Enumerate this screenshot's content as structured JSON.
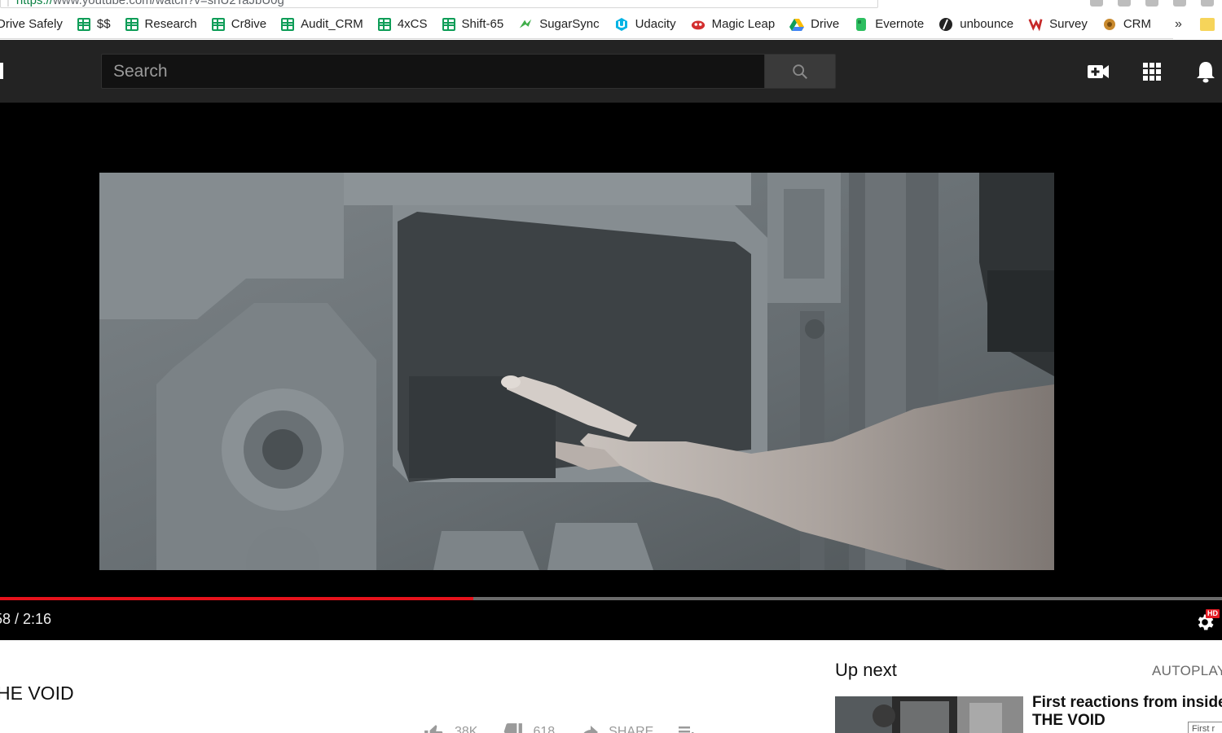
{
  "browser": {
    "url_scheme": "https://",
    "url_rest": "www.youtube.com/watch?v=shU2TaJbU0g",
    "bookmarks": [
      {
        "label": "Drive Safely",
        "icon": "doc-icon"
      },
      {
        "label": "$$",
        "icon": "sheets-icon"
      },
      {
        "label": "Research",
        "icon": "sheets-icon"
      },
      {
        "label": "Cr8ive",
        "icon": "sheets-icon"
      },
      {
        "label": "Audit_CRM",
        "icon": "sheets-icon"
      },
      {
        "label": "4xCS",
        "icon": "sheets-icon"
      },
      {
        "label": "Shift-65",
        "icon": "sheets-icon"
      },
      {
        "label": "SugarSync",
        "icon": "sugarsync-icon"
      },
      {
        "label": "Udacity",
        "icon": "udacity-icon"
      },
      {
        "label": "Magic Leap",
        "icon": "magic-leap-icon"
      },
      {
        "label": "Drive",
        "icon": "google-drive-icon"
      },
      {
        "label": "Evernote",
        "icon": "evernote-icon"
      },
      {
        "label": "unbounce",
        "icon": "unbounce-icon"
      },
      {
        "label": "Survey",
        "icon": "survey-icon"
      },
      {
        "label": "CRM",
        "icon": "crm-icon"
      }
    ],
    "more_chevron": "»"
  },
  "masthead": {
    "search_placeholder": "Search"
  },
  "player": {
    "time_display": "58 / 2:16",
    "progress_fraction": 0.387,
    "hd_badge": "HD"
  },
  "video": {
    "title": "HE VOID",
    "likes": "38K",
    "dislikes": "618",
    "share_label": "SHARE",
    "more_label": "..."
  },
  "sidebar": {
    "up_next_label": "Up next",
    "autoplay_label": "AUTOPLAY",
    "next_video_title": "First reactions from inside THE VOID",
    "next_tooltip": "First r"
  },
  "colors": {
    "accent_red": "#e6121c",
    "masthead_bg": "#232323",
    "sheets_green": "#0f9d58"
  }
}
